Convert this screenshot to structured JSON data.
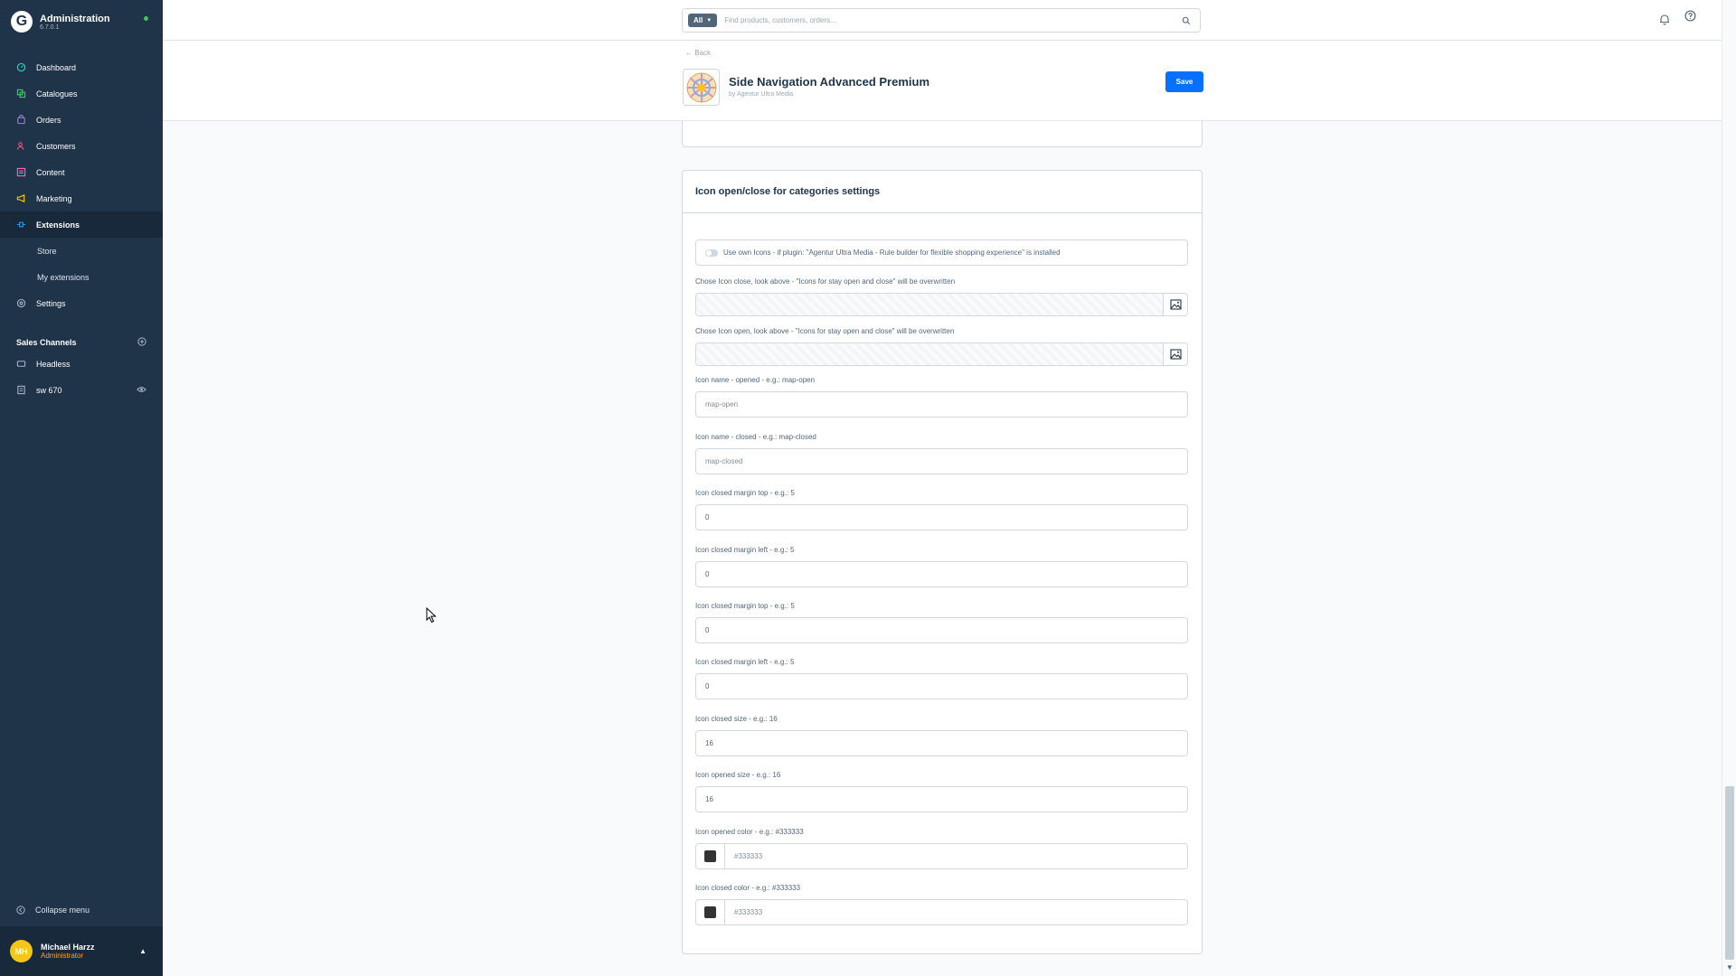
{
  "brand": {
    "title": "Administration",
    "version": "6.7.0.1"
  },
  "nav": {
    "dashboard": "Dashboard",
    "catalogues": "Catalogues",
    "orders": "Orders",
    "customers": "Customers",
    "content": "Content",
    "marketing": "Marketing",
    "extensions": "Extensions",
    "store": "Store",
    "my_extensions": "My extensions",
    "settings": "Settings"
  },
  "sales_channels": {
    "title": "Sales Channels",
    "items": [
      "Headless",
      "sw 670"
    ]
  },
  "collapse_menu": "Collapse menu",
  "user": {
    "initials": "MH",
    "name": "Michael Harzz",
    "role": "Administrator"
  },
  "search": {
    "type": "All",
    "placeholder": "Find products, customers, orders..."
  },
  "header": {
    "back": "Back",
    "plugin_title": "Side Navigation Advanced Premium",
    "plugin_by": "by Agentur Ultra Media",
    "save": "Save"
  },
  "card": {
    "title": "Icon open/close for categories settings",
    "switch_label": "Use own Icons - if plugin: \"Agentur Ultra Media - Rule builder for flexible shopping experience\" is installed",
    "media_close_label": "Chose Icon close, look above - \"Icons for stay open and close\" will be overwritten",
    "media_open_label": "Chose Icon open, look above - \"Icons for stay open and close\" will be overwritten",
    "fields": [
      {
        "label": "Icon name - opened - e.g.: map-open",
        "value": "map-open",
        "placeholder": true
      },
      {
        "label": "Icon name - closed - e.g.: map-closed",
        "value": "map-closed",
        "placeholder": true
      },
      {
        "label": "Icon closed margin top - e.g.: 5",
        "value": "0"
      },
      {
        "label": "Icon closed margin left - e.g.: 5",
        "value": "0"
      },
      {
        "label": "Icon closed margin top - e.g.: 5",
        "value": "0"
      },
      {
        "label": "Icon closed margin left - e.g.: 5",
        "value": "0"
      },
      {
        "label": "Icon closed size - e.g.: 16",
        "value": "16"
      },
      {
        "label": "Icon opened size - e.g.: 16",
        "value": "16"
      }
    ],
    "color_fields": [
      {
        "label": "Icon opened color - e.g.: #333333",
        "value": "#333333",
        "swatch": "#333333"
      },
      {
        "label": "Icon closed color - e.g.: #333333",
        "value": "#333333",
        "swatch": "#333333"
      }
    ]
  },
  "colors": {
    "sidebar": "#1f3349",
    "accent": "#0870ff",
    "online": "#37d046",
    "role": "#f5a623",
    "avatar": "#f5c518"
  }
}
